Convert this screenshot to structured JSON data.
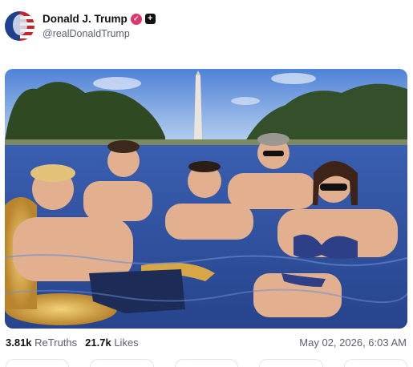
{
  "post": {
    "display_name": "Donald J. Trump",
    "handle": "@realDonaldTrump",
    "verified_icon": "verified-badge-icon",
    "plus_icon": "plus-badge-icon",
    "avatar_icon": "avatar"
  },
  "stats": {
    "retruths_value": "3.81k",
    "retruths_label": "ReTruths",
    "likes_value": "21.7k",
    "likes_label": "Likes"
  },
  "timestamp": "May 02, 2026, 6:03 AM",
  "media": {
    "description_icon": "post-image"
  },
  "colors": {
    "verified": "#e0356f",
    "muted_text": "#5b6170"
  }
}
